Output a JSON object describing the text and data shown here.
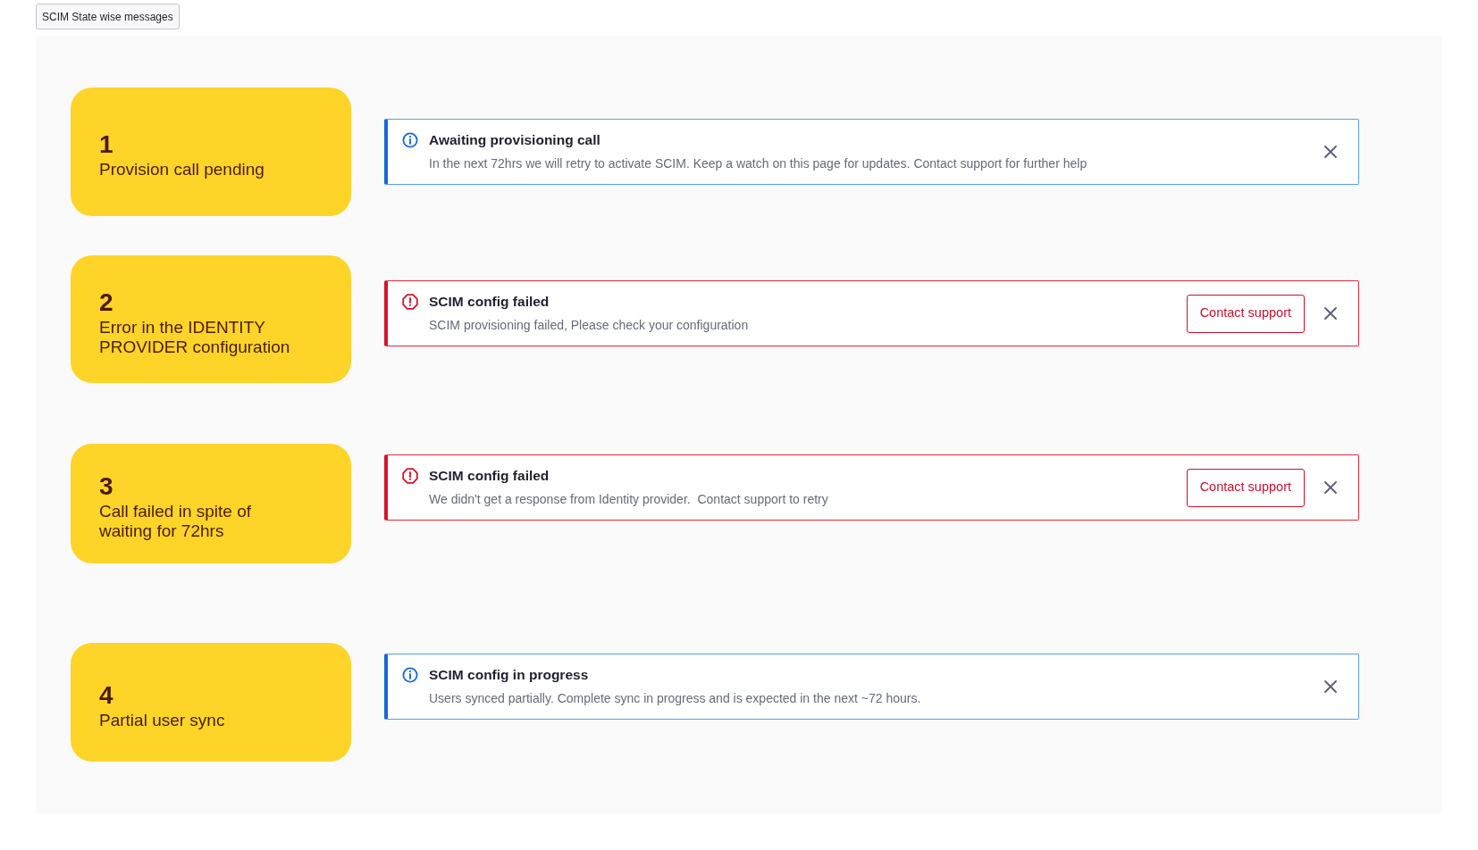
{
  "header_button": {
    "label": "SCIM State wise messages"
  },
  "states": [
    {
      "number": "1",
      "label": "Provision call pending",
      "alert": {
        "kind": "info",
        "title": "Awaiting provisioning call",
        "message": "In the next 72hrs we will retry to activate SCIM. Keep a watch on this page for updates. Contact support for further help"
      }
    },
    {
      "number": "2",
      "label": "Error in the IDENTITY PROVIDER configuration",
      "alert": {
        "kind": "error",
        "title": "SCIM config failed",
        "message": "SCIM provisioning failed, Please check your configuration",
        "action": "Contact support"
      }
    },
    {
      "number": "3",
      "label": "Call failed in spite of waiting for 72hrs",
      "alert": {
        "kind": "error",
        "title": "SCIM config failed",
        "message": "We didn't get a response from Identity provider.  Contact support to retry",
        "action": "Contact support"
      }
    },
    {
      "number": "4",
      "label": "Partial user sync",
      "alert": {
        "kind": "info",
        "title": "SCIM config in progress",
        "message": "Users synced partially. Complete sync in progress and is expected in the next ~72 hours."
      }
    }
  ]
}
